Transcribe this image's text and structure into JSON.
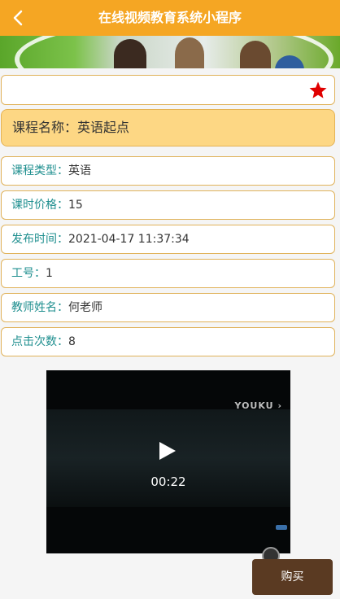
{
  "topbar": {
    "title": "在线视频教育系统小程序",
    "back_icon": "chevron-left-icon"
  },
  "favorite": {
    "icon": "star-icon",
    "color": "#e00000"
  },
  "course_name": {
    "label": "课程名称：",
    "value": "英语起点"
  },
  "details": [
    {
      "label": "课程类型：",
      "value": "英语"
    },
    {
      "label": "课时价格：",
      "value": "15"
    },
    {
      "label": "发布时间：",
      "value": "2021-04-17 11:37:34"
    },
    {
      "label": "工号：",
      "value": "1"
    },
    {
      "label": "教师姓名：",
      "value": "何老师"
    },
    {
      "label": "点击次数：",
      "value": "8"
    }
  ],
  "video": {
    "watermark": "YOUKU",
    "time": "00:22",
    "play_icon": "play-icon"
  },
  "buy_button": {
    "label": "购买"
  },
  "colors": {
    "topbar": "#f5a623",
    "name_row": "#fdd784",
    "label_text": "#1f8f8f",
    "buy_button": "#5a3a22"
  }
}
